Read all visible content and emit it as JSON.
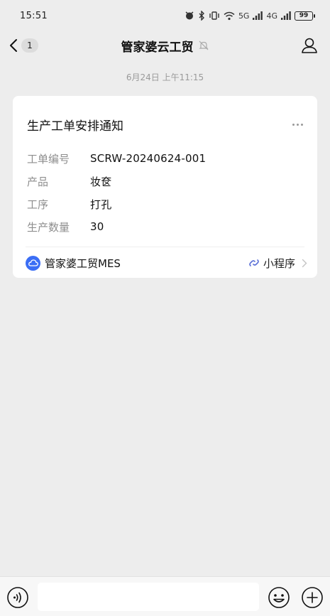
{
  "status_bar": {
    "time": "15:51",
    "signal_a": "5G",
    "signal_b": "4G",
    "battery": "99"
  },
  "nav": {
    "unread_count": "1",
    "title": "管家婆云工贸",
    "icons": {
      "back": "chevron-left-icon",
      "mute": "bell-off-icon",
      "profile": "person-icon"
    }
  },
  "chat": {
    "timestamp": "6月24日 上午11:15"
  },
  "card": {
    "title": "生产工单安排通知",
    "fields": [
      {
        "label": "工单编号",
        "value": "SCRW-20240624-001"
      },
      {
        "label": "产品",
        "value": "妆奁"
      },
      {
        "label": "工序",
        "value": "打孔"
      },
      {
        "label": "生产数量",
        "value": "30"
      }
    ],
    "app_name": "管家婆工贸MES",
    "miniprogram_label": "小程序",
    "colors": {
      "app_logo": "#3b6ef5",
      "miniprogram_icon": "#5a6fd6"
    }
  },
  "input_bar": {
    "placeholder": "",
    "icons": {
      "voice": "voice-icon",
      "emoji": "emoji-icon",
      "plus": "plus-icon"
    }
  }
}
